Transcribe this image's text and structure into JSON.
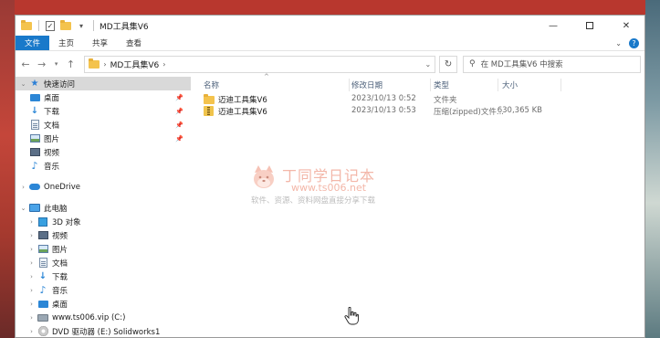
{
  "window": {
    "title": "MD工具集V6",
    "controls": [
      "minimize-icon",
      "maximize-icon",
      "close-icon"
    ]
  },
  "ribbon": {
    "tabs": [
      "文件",
      "主页",
      "共享",
      "查看"
    ]
  },
  "address": {
    "path_segments": [
      "MD工具集V6"
    ],
    "search_placeholder": "在 MD工具集V6 中搜索"
  },
  "nav": {
    "items": [
      {
        "label": "快速访问",
        "icon": "star-icon",
        "level": 0,
        "selected": true
      },
      {
        "label": "桌面",
        "icon": "desktop-icon",
        "level": 1,
        "pinned": true
      },
      {
        "label": "下载",
        "icon": "download-icon",
        "level": 1,
        "pinned": true
      },
      {
        "label": "文档",
        "icon": "document-icon",
        "level": 1,
        "pinned": true
      },
      {
        "label": "图片",
        "icon": "picture-icon",
        "level": 1,
        "pinned": true
      },
      {
        "label": "视频",
        "icon": "video-icon",
        "level": 1
      },
      {
        "label": "音乐",
        "icon": "music-icon",
        "level": 1
      },
      {
        "label": "OneDrive",
        "icon": "cloud-icon",
        "level": 0
      },
      {
        "label": "此电脑",
        "icon": "computer-icon",
        "level": 0
      },
      {
        "label": "3D 对象",
        "icon": "3d-objects-icon",
        "level": 1
      },
      {
        "label": "视频",
        "icon": "video-icon",
        "level": 1
      },
      {
        "label": "图片",
        "icon": "picture-icon",
        "level": 1
      },
      {
        "label": "文档",
        "icon": "document-icon",
        "level": 1
      },
      {
        "label": "下载",
        "icon": "download-icon",
        "level": 1
      },
      {
        "label": "音乐",
        "icon": "music-icon",
        "level": 1
      },
      {
        "label": "桌面",
        "icon": "desktop-icon",
        "level": 1
      },
      {
        "label": "www.ts006.vip (C:)",
        "icon": "drive-icon",
        "level": 1
      },
      {
        "label": "DVD 驱动器 (E:) Solidworks1",
        "icon": "dvd-icon",
        "level": 1
      }
    ]
  },
  "columns": {
    "name": "名称",
    "date": "修改日期",
    "type": "类型",
    "size": "大小"
  },
  "files": [
    {
      "name": "迈迪工具集V6",
      "date": "2023/10/13 0:52",
      "type": "文件夹",
      "size": "",
      "icon": "folder-icon"
    },
    {
      "name": "迈迪工具集V6",
      "date": "2023/10/13 0:53",
      "type": "压缩(zipped)文件...",
      "size": "630,365 KB",
      "icon": "zip-icon"
    }
  ],
  "watermark": {
    "title": "丁同学日记本",
    "url": "www.ts006.net",
    "subtitle": "软件、资源、资料网盘直接分享下载"
  },
  "colors": {
    "accent": "#1979ca",
    "selected_bg": "#d9d9d9",
    "watermark": "#f3b7a9"
  }
}
